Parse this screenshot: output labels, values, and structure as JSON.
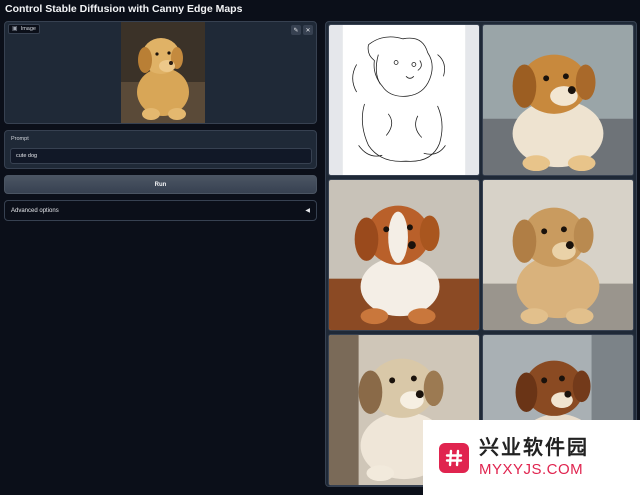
{
  "page": {
    "title": "Control Stable Diffusion with Canny Edge Maps"
  },
  "image_input": {
    "label": "Image",
    "label_icon": "image-icon",
    "edit_icon": "pencil-icon",
    "close_icon": "close-icon"
  },
  "prompt": {
    "label": "Prompt",
    "value": "cute dog"
  },
  "run": {
    "label": "Run"
  },
  "advanced": {
    "label": "Advanced options",
    "icon": "triangle-left-icon"
  },
  "gallery": {
    "items": [
      {
        "kind": "edge-map"
      },
      {
        "kind": "puppy",
        "fur": "#c8893d"
      },
      {
        "kind": "puppy",
        "fur": "#b9602a"
      },
      {
        "kind": "puppy",
        "fur": "#c99b5f"
      },
      {
        "kind": "puppy",
        "fur": "#d9c8a8"
      },
      {
        "kind": "puppy",
        "fur": "#8a4a22"
      }
    ]
  },
  "watermark": {
    "cn": "兴业软件园",
    "en": "MYXYJS.COM"
  },
  "colors": {
    "bg": "#0b0f19",
    "panel": "#1f2937",
    "border": "#374151",
    "accent": "#e0244f"
  }
}
